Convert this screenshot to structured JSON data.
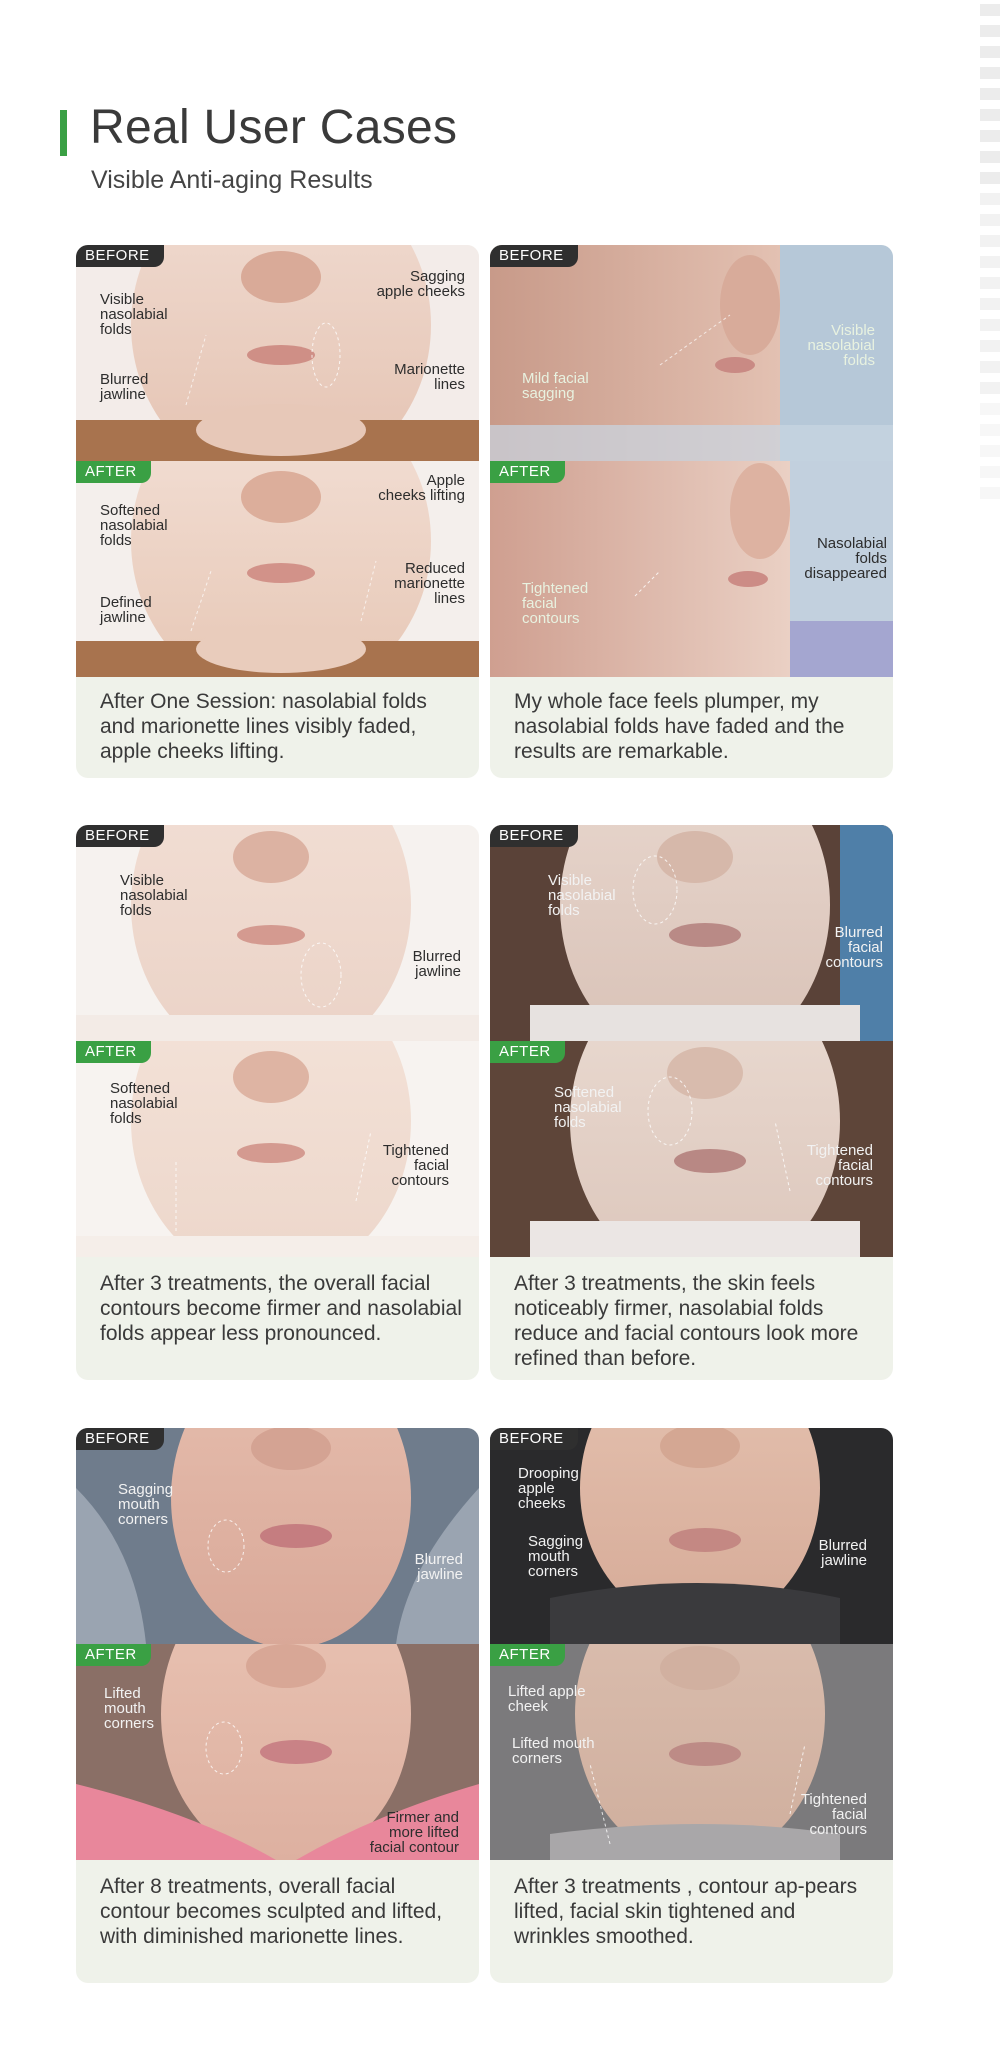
{
  "header": {
    "title": "Real User Cases",
    "subtitle": "Visible Anti-aging Results"
  },
  "tags": {
    "before": "BEFORE",
    "after": "AFTER"
  },
  "colors": {
    "accent": "#3aa044",
    "card_bg": "#eff2ea",
    "tag_dark": "#2f2f2f"
  },
  "cases": [
    {
      "before_labels": [
        "Visible\nnasolabial\nfolds",
        "Sagging\napple cheeks",
        "Blurred\njawline",
        "Marionette\nlines"
      ],
      "after_labels": [
        "Softened\nnasolabial\nfolds",
        "Apple\ncheeks lifting",
        "Defined\njawline",
        "Reduced\nmarionette\nlines"
      ],
      "description": "After One Session: nasolabial folds and marionette lines visibly faded, apple cheeks lifting."
    },
    {
      "before_labels": [
        "Visible\nnasolabial\nfolds",
        "Mild facial\nsagging"
      ],
      "after_labels": [
        "Nasolabial\nfolds\ndisappeared",
        "Tightened\nfacial\ncontours"
      ],
      "description": "My whole face feels plumper, my nasolabial folds have faded and the results are remarkable."
    },
    {
      "before_labels": [
        "Visible\nnasolabial\nfolds",
        "Blurred\njawline"
      ],
      "after_labels": [
        "Softened\nnasolabial\nfolds",
        "Tightened\nfacial\ncontours"
      ],
      "description": "After 3 treatments, the overall facial contours become firmer and nasolabial folds appear less pronounced."
    },
    {
      "before_labels": [
        "Visible\nnasolabial\nfolds",
        "Blurred\nfacial\ncontours"
      ],
      "after_labels": [
        "Softened\nnasolabial\nfolds",
        "Tightened\nfacial\ncontours"
      ],
      "description": "After 3 treatments, the skin feels noticeably firmer, nasolabial folds reduce and facial contours look more refined than before."
    },
    {
      "before_labels": [
        "Sagging\nmouth\ncorners",
        "Blurred\njawline"
      ],
      "after_labels": [
        "Lifted\nmouth\ncorners",
        "Firmer and\nmore lifted\nfacial contour"
      ],
      "description": "After 8 treatments, overall facial contour becomes sculpted and lifted, with diminished marionette lines."
    },
    {
      "before_labels": [
        "Drooping\napple\ncheeks",
        "Sagging\nmouth\ncorners",
        "Blurred\njawline"
      ],
      "after_labels": [
        "Lifted apple\ncheek",
        "Lifted mouth\ncorners",
        "Tightened\nfacial\ncontours"
      ],
      "description": "After 3 treatments , contour ap-pears lifted, facial skin tightened and wrinkles smoothed."
    }
  ]
}
